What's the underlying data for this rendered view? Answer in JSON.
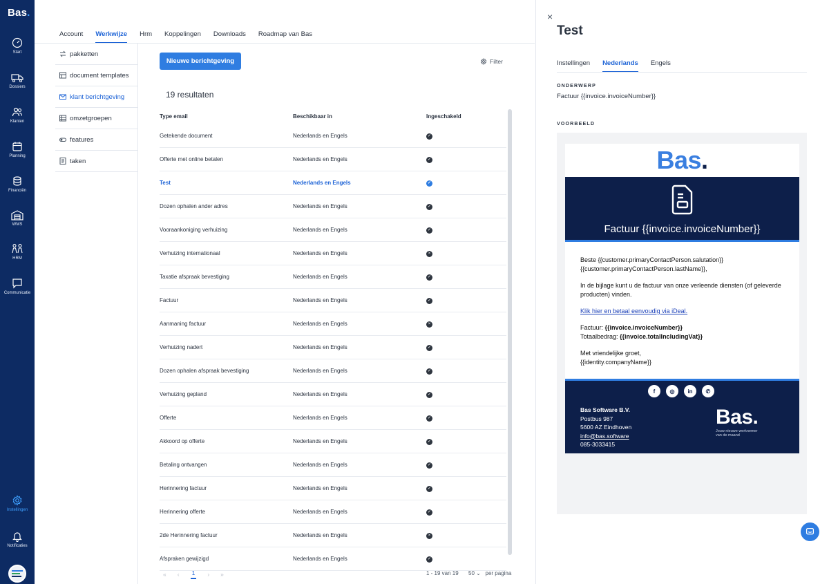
{
  "rail": {
    "logo": "Bas",
    "logo_dot": ".",
    "items": [
      {
        "label": "Start"
      },
      {
        "label": "Dossiers"
      },
      {
        "label": "Klanten"
      },
      {
        "label": "Planning"
      },
      {
        "label": "Financiën"
      },
      {
        "label": "WMS"
      },
      {
        "label": "HRM"
      },
      {
        "label": "Communicatie"
      }
    ],
    "bottom": [
      {
        "label": "Instellingen"
      },
      {
        "label": "Notificaties"
      }
    ]
  },
  "topnav": {
    "tabs": [
      "Account",
      "Werkwijze",
      "Hrm",
      "Koppelingen",
      "Downloads",
      "Roadmap van Bas"
    ],
    "active": "Werkwijze"
  },
  "subnav": {
    "items": [
      "pakketten",
      "document templates",
      "klant berichtgeving",
      "omzetgroepen",
      "features",
      "taken"
    ],
    "active": "klant berichtgeving"
  },
  "main": {
    "new_button": "Nieuwe berichtgeving",
    "filter": "Filter",
    "results": "19 resultaten",
    "columns": [
      "Type email",
      "Beschikbaar in",
      "Ingeschakeld"
    ],
    "rows": [
      {
        "type": "Getekende document",
        "lang": "Nederlands en Engels",
        "enabled": "check"
      },
      {
        "type": "Offerte met online betalen",
        "lang": "Nederlands en Engels",
        "enabled": "check"
      },
      {
        "type": "Test",
        "lang": "Nederlands en Engels",
        "enabled": "check"
      },
      {
        "type": "Dozen ophalen ander adres",
        "lang": "Nederlands en Engels",
        "enabled": "check"
      },
      {
        "type": "Vooraankoniging verhuizing",
        "lang": "Nederlands en Engels",
        "enabled": "check"
      },
      {
        "type": "Verhuizing internationaal",
        "lang": "Nederlands en Engels",
        "enabled": "cross"
      },
      {
        "type": "Taxatie afspraak bevestiging",
        "lang": "Nederlands en Engels",
        "enabled": "check"
      },
      {
        "type": "Factuur",
        "lang": "Nederlands en Engels",
        "enabled": "check"
      },
      {
        "type": "Aanmaning factuur",
        "lang": "Nederlands en Engels",
        "enabled": "cross"
      },
      {
        "type": "Verhuizing nadert",
        "lang": "Nederlands en Engels",
        "enabled": "check"
      },
      {
        "type": "Dozen ophalen afspraak bevestiging",
        "lang": "Nederlands en Engels",
        "enabled": "check"
      },
      {
        "type": "Verhuizing gepland",
        "lang": "Nederlands en Engels",
        "enabled": "check"
      },
      {
        "type": "Offerte",
        "lang": "Nederlands en Engels",
        "enabled": "check"
      },
      {
        "type": "Akkoord op offerte",
        "lang": "Nederlands en Engels",
        "enabled": "check"
      },
      {
        "type": "Betaling ontvangen",
        "lang": "Nederlands en Engels",
        "enabled": "check"
      },
      {
        "type": "Herinnering factuur",
        "lang": "Nederlands en Engels",
        "enabled": "check"
      },
      {
        "type": "Herinnering offerte",
        "lang": "Nederlands en Engels",
        "enabled": "check"
      },
      {
        "type": "2de Herinnering factuur",
        "lang": "Nederlands en Engels",
        "enabled": "cross"
      },
      {
        "type": "Afspraken gewijzigd",
        "lang": "Nederlands en Engels",
        "enabled": "check"
      }
    ],
    "selected_row": "Test",
    "pager": {
      "first": "«",
      "prev": "‹",
      "current": "1",
      "next": "›",
      "last": "»",
      "info": "1 - 19 van 19",
      "per_page_value": "50",
      "per_page_label": "per pagina"
    }
  },
  "drawer": {
    "close": "×",
    "title": "Test",
    "tabs": [
      "Instellingen",
      "Nederlands",
      "Engels"
    ],
    "active_tab": "Nederlands",
    "subject_label": "ONDERWERP",
    "subject_value": "Factuur {{invoice.invoiceNumber}}",
    "preview_label": "VOORBEELD",
    "mail": {
      "brand": "Bas",
      "brand_dot": ".",
      "hero_title": "Factuur {{invoice.invoiceNumber}}",
      "greeting_1": "Beste {{customer.primaryContactPerson.salutation}}",
      "greeting_2": "{{customer.primaryContactPerson.lastName}},",
      "intro": "In de bijlage kunt u de factuur van onze verleende diensten (of geleverde producten) vinden.",
      "link": "Klik hier en betaal eenvoudig via iDeal.",
      "invoice_label": "Factuur: ",
      "invoice_value": "{{invoice.invoiceNumber}}",
      "total_label": "Totaalbedrag: ",
      "total_value": "{{invoice.totalIncludingVat}}",
      "closing_1": "Met vriendelijke groet,",
      "closing_2": "{{identity.companyName}}",
      "socials": [
        "f",
        "◎",
        "in",
        "✆"
      ],
      "company": "Bas Software B.V.",
      "address_1": "Postbus 987",
      "address_2": "5600 AZ Eindhoven",
      "email": "info@bas.software",
      "phone": "085-3033415",
      "foot_brand": "Bas.",
      "tagline_1": "Jouw nieuwe werknemer",
      "tagline_2": "van de maand"
    }
  }
}
